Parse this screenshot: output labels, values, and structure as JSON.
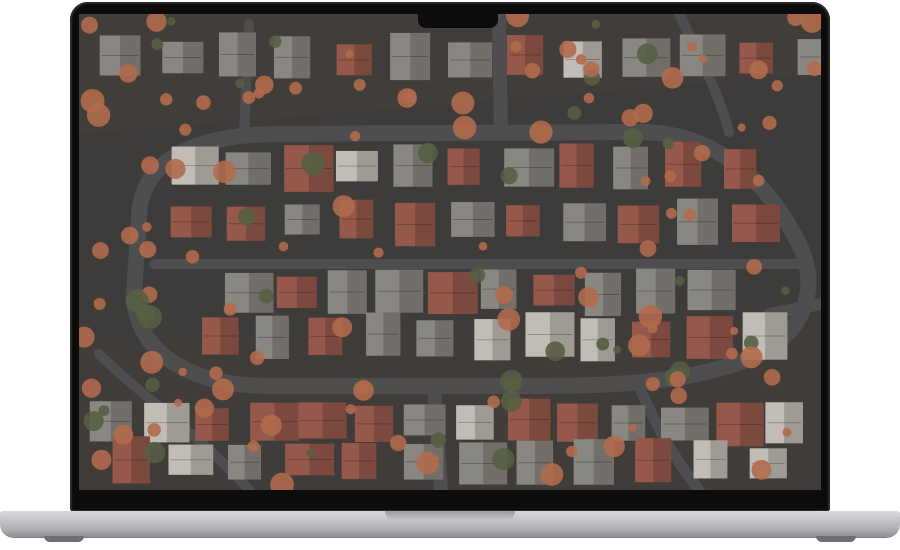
{
  "device": {
    "type": "laptop",
    "colors": {
      "bezel": "#0c0c0d",
      "chassis": "#c3c5c8",
      "ground": "#3c3e3f",
      "road": "#4a4d50",
      "roof_red": "#9a5a4d",
      "roof_light": "#c9c6c0",
      "roof_gray": "#8d8c88",
      "tree_autumn": "#b86e4f",
      "tree_green": "#556046"
    }
  },
  "screen": {
    "content": "aerial-suburb-photo",
    "icons": [
      "house-icon",
      "tree-icon",
      "road-icon"
    ]
  }
}
